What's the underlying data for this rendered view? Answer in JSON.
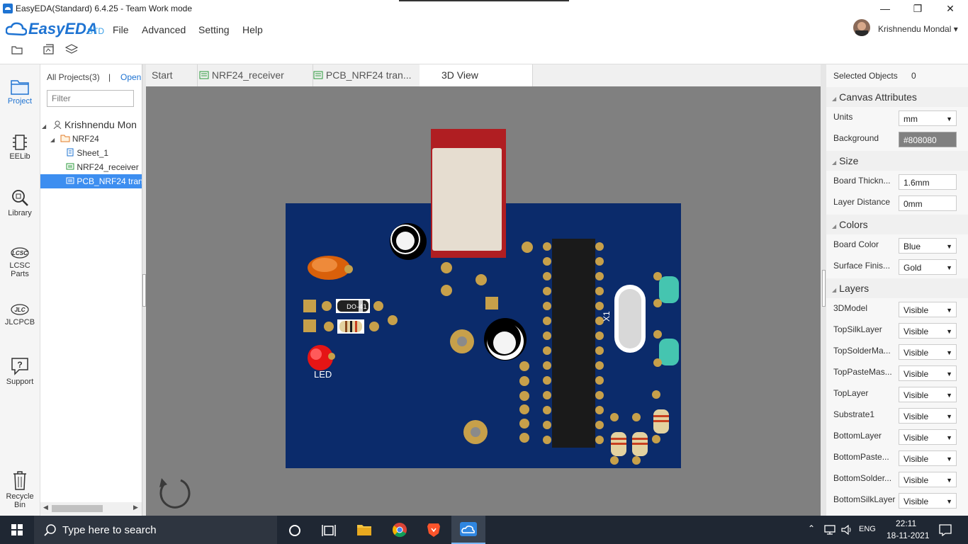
{
  "window": {
    "title": "EasyEDA(Standard) 6.4.25 - Team Work mode",
    "controls": [
      "minimize-icon",
      "maximize-icon",
      "close-icon"
    ]
  },
  "brand": {
    "logo_text": "EasyEDA",
    "edition": "STD"
  },
  "menu": [
    "File",
    "Advanced",
    "Setting",
    "Help"
  ],
  "user": {
    "name": "Krishnendu Mondal ▾"
  },
  "left_nav": [
    {
      "label": "Project",
      "icon": "folder-icon",
      "active": true
    },
    {
      "label": "EELib",
      "icon": "chip-icon"
    },
    {
      "label": "Library",
      "icon": "search-library-icon"
    },
    {
      "label": "LCSC Parts",
      "icon": "lcsc-icon"
    },
    {
      "label": "JLCPCB",
      "icon": "jlc-icon"
    },
    {
      "label": "Support",
      "icon": "help-icon"
    },
    {
      "label": "Recycle Bin",
      "icon": "trash-icon"
    }
  ],
  "project_panel": {
    "all_projects": "All Projects(3)",
    "separator": "|",
    "open": "Open",
    "filter_placeholder": "Filter",
    "tree": [
      {
        "label": "Krishnendu Mon",
        "icon": "user-icon",
        "level": 0,
        "toggle": "◢"
      },
      {
        "label": "NRF24",
        "icon": "folder-icon",
        "level": 1,
        "toggle": "◢"
      },
      {
        "label": "Sheet_1",
        "icon": "schematic-icon",
        "level": 2
      },
      {
        "label": "NRF24_receiver",
        "icon": "pcb-icon",
        "level": 2
      },
      {
        "label": "PCB_NRF24 tran",
        "icon": "pcb-icon",
        "level": 2,
        "selected": true
      }
    ]
  },
  "tabs": [
    {
      "label": "Start",
      "icon": ""
    },
    {
      "label": "NRF24_receiver",
      "icon": "pcb-icon"
    },
    {
      "label": "PCB_NRF24 tran...",
      "icon": "pcb-icon"
    },
    {
      "label": "3D View",
      "icon": "",
      "active": true
    }
  ],
  "canvas": {
    "background": "#808080",
    "board_color": "#0b2b6b",
    "silk_labels": {
      "led": "LED",
      "diode": "DO-41",
      "crystal": "X1"
    }
  },
  "right_panel": {
    "selected_label": "Selected Objects",
    "selected_count": "0",
    "sections": [
      {
        "title": "Canvas Attributes",
        "rows": [
          {
            "label": "Units",
            "value": "mm",
            "dropdown": true
          },
          {
            "label": "Background",
            "value": "#808080",
            "dropdown": false,
            "swatch": true
          }
        ]
      },
      {
        "title": "Size",
        "rows": [
          {
            "label": "Board Thickn...",
            "value": "1.6mm",
            "dropdown": false
          },
          {
            "label": "Layer Distance",
            "value": "0mm",
            "dropdown": false
          }
        ]
      },
      {
        "title": "Colors",
        "rows": [
          {
            "label": "Board Color",
            "value": "Blue",
            "dropdown": true
          },
          {
            "label": "Surface Finis...",
            "value": "Gold",
            "dropdown": true
          }
        ]
      },
      {
        "title": "Layers",
        "rows": [
          {
            "label": "3DModel",
            "value": "Visible",
            "dropdown": true
          },
          {
            "label": "TopSilkLayer",
            "value": "Visible",
            "dropdown": true
          },
          {
            "label": "TopSolderMa...",
            "value": "Visible",
            "dropdown": true
          },
          {
            "label": "TopPasteMas...",
            "value": "Visible",
            "dropdown": true
          },
          {
            "label": "TopLayer",
            "value": "Visible",
            "dropdown": true
          },
          {
            "label": "Substrate1",
            "value": "Visible",
            "dropdown": true
          },
          {
            "label": "BottomLayer",
            "value": "Visible",
            "dropdown": true
          },
          {
            "label": "BottomPaste...",
            "value": "Visible",
            "dropdown": true
          },
          {
            "label": "BottomSolder...",
            "value": "Visible",
            "dropdown": true
          },
          {
            "label": "BottomSilkLayer",
            "value": "Visible",
            "dropdown": true
          }
        ]
      }
    ]
  },
  "taskbar": {
    "search_placeholder": "Type here to search",
    "lang": "ENG",
    "time": "22:11",
    "date": "18-11-2021"
  }
}
